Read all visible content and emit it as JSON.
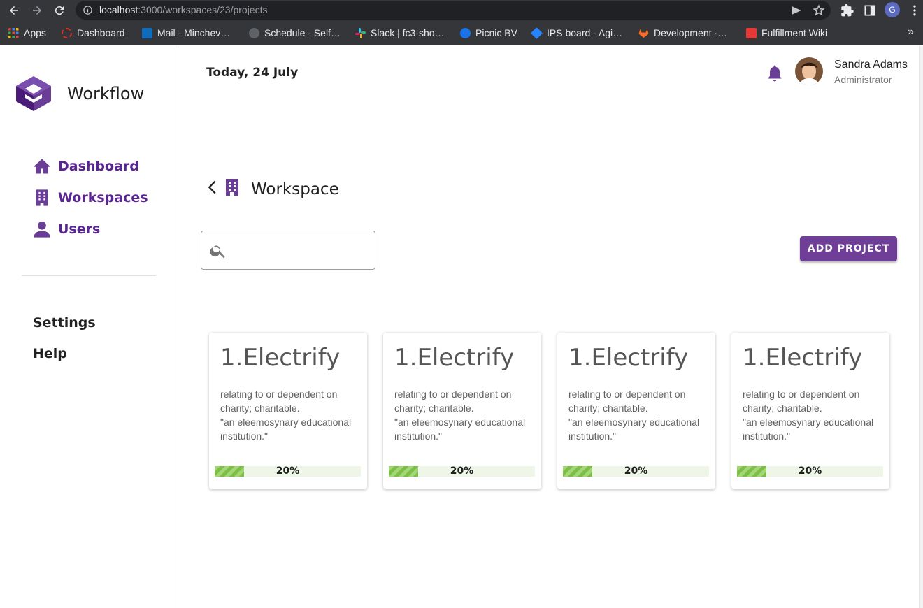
{
  "browser": {
    "url_host": "localhost",
    "url_rest": ":3000/workspaces/23/projects",
    "profile_initial": "G",
    "bookmarks": [
      {
        "label": "Apps",
        "color": "#e8453c"
      },
      {
        "label": "Dashboard",
        "color": "#d93025"
      },
      {
        "label": "Mail - Minchev…",
        "color": "#0f6cbd"
      },
      {
        "label": "Schedule - Self…",
        "color": "#5f6368"
      },
      {
        "label": "Slack | fc3-sho…",
        "color": "#4a154b"
      },
      {
        "label": "Picnic BV",
        "color": "#1a73e8"
      },
      {
        "label": "IPS board - Agi…",
        "color": "#2684ff"
      },
      {
        "label": "Development ·…",
        "color": "#e24329"
      },
      {
        "label": "Fulfillment Wiki",
        "color": "#e53935"
      }
    ]
  },
  "sidebar": {
    "brand": "Workflow",
    "nav": [
      {
        "label": "Dashboard",
        "icon": "home-icon"
      },
      {
        "label": "Workspaces",
        "icon": "building-icon"
      },
      {
        "label": "Users",
        "icon": "user-icon"
      }
    ],
    "settings": "Settings",
    "help": "Help"
  },
  "header": {
    "date": "Today, 24 July",
    "user_name": "Sandra Adams",
    "user_role": "Administrator"
  },
  "workspace": {
    "title": "Workspace",
    "search_placeholder": "",
    "add_button": "ADD PROJECT"
  },
  "projects": [
    {
      "title": "1.Electrify",
      "description": "relating to or dependent on charity; charitable.\n\"an eleemosynary educational institution.\"",
      "progress": 20,
      "progress_label": "20%"
    },
    {
      "title": "1.Electrify",
      "description": "relating to or dependent on charity; charitable.\n\"an eleemosynary educational institution.\"",
      "progress": 20,
      "progress_label": "20%"
    },
    {
      "title": "1.Electrify",
      "description": "relating to or dependent on charity; charitable.\n\"an eleemosynary educational institution.\"",
      "progress": 20,
      "progress_label": "20%"
    },
    {
      "title": "1.Electrify",
      "description": "relating to or dependent on charity; charitable.\n\"an eleemosynary educational institution.\"",
      "progress": 20,
      "progress_label": "20%"
    }
  ],
  "colors": {
    "accent": "#6f3f97",
    "progress": "#7cbf45"
  }
}
